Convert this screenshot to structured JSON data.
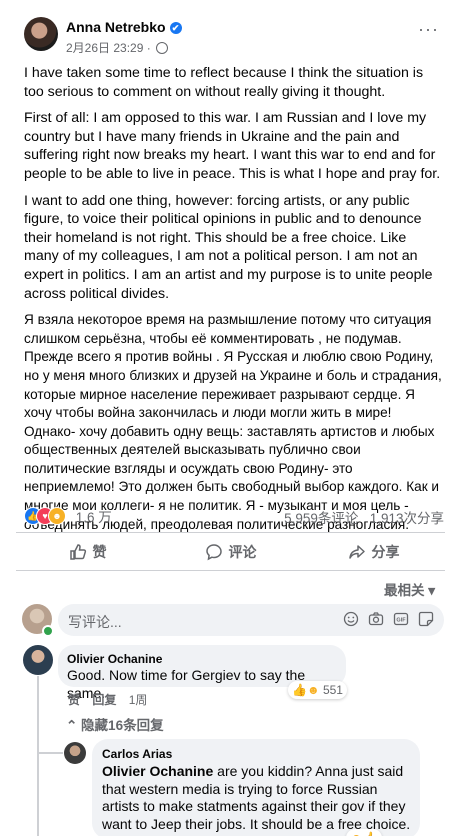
{
  "post": {
    "author": "Anna Netrebko",
    "verified_mark": "✔",
    "timestamp": "2月26日 23:29",
    "dot": "·",
    "more": "···",
    "paragraphs": [
      "I have taken some time to reflect because I think the situation is too serious to comment on without really giving it thought.",
      "First of all: I am opposed to this war. I am Russian and I love my country but I have many friends in Ukraine and the pain and suffering right now breaks my heart. I want this war to end and for people to be able to live in peace. This is what I hope and pray for.",
      "I want to add one thing, however: forcing artists, or any public figure, to voice their political opinions in public and to denounce their homeland is not right. This should be a free choice. Like many of my colleagues, I am not a political person. I am not an expert in politics. I am an artist and my purpose is to unite people across political divides.",
      "Я взяла некоторое время на размышление потому что ситуация слишком серьёзна, чтобы её комментировать , не подумав. Прежде всего я против войны . Я Русская и люблю свою Родину, но у меня много близких и друзей на Украине и боль и страдания, которые мирное население переживает разрывают сердце. Я хочу чтобы война закончилась и люди могли жить в мире!   Однако- хочу добавить одну вещь: заставлять артистов и любых общественных деятелей высказывать публично свои политические взгляды и осуждать свою Родину- это неприемлемо! Это должен быть свободный выбор каждого. Как и многие мои коллеги- я не политик. Я - музыкант и моя цель - объединять людей, преодолевая политические разногласия."
    ],
    "reaction_count": "1.6 万",
    "comment_count": "5,959条评论",
    "share_count": "1,913次分享",
    "reactions": [
      "like-icon",
      "love-icon",
      "haha-icon"
    ]
  },
  "actions": {
    "like": "赞",
    "comment": "评论",
    "share": "分享"
  },
  "comments_sort": "最相关 ▾",
  "comment_input": {
    "placeholder": "写评论...",
    "icons": [
      "emoji-icon",
      "camera-icon",
      "gif-icon",
      "sticker-icon"
    ]
  },
  "comments": [
    {
      "name": "Olivier Ochanine",
      "text": "Good. Now time for Gergiev to say the same.",
      "like": "赞",
      "reply": "回复",
      "time": "1周",
      "reaction_count": "551"
    }
  ],
  "hidden_replies": "⌃ 隐藏16条回复",
  "reply": {
    "name": "Carlos Arias",
    "mention": "Olivier Ochanine",
    "text": " are you kiddin? Anna just said that western media is trying to force Russian artists to make statments against their gov if they want to Jeep their jobs. It should be a free choice."
  },
  "colors": {
    "accent": "#1877f2",
    "muted_text": "#65676b",
    "bubble_bg": "#f0f2f5"
  }
}
